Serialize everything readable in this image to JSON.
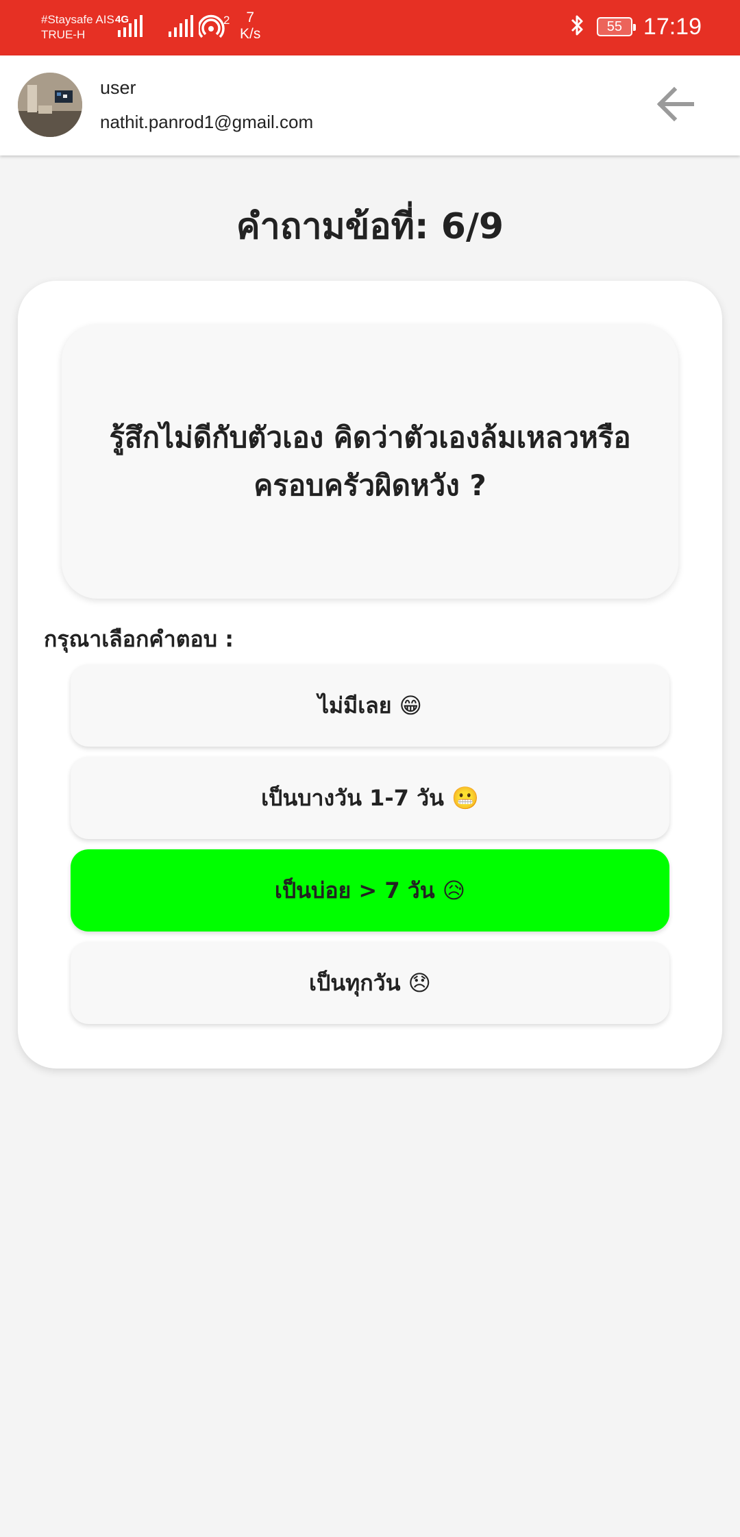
{
  "status_bar": {
    "carrier_line1": "#Staysafe AIS",
    "carrier_line2": "TRUE-H",
    "network": "4G",
    "hotspot_count": "2",
    "speed_value": "7",
    "speed_unit": "K/s",
    "battery": "55",
    "time": "17:19",
    "background_color": "#e63024"
  },
  "header": {
    "user_name": "user",
    "user_email": "nathit.panrod1@gmail.com",
    "back_icon": "arrow-left-icon"
  },
  "quiz": {
    "title": "คำถามข้อที่: 6/9",
    "question": "รู้สึกไม่ดีกับตัวเอง คิดว่าตัวเองล้มเหลวหรือครอบครัวผิดหวัง ?",
    "prompt": "กรุณาเลือกคำตอบ :",
    "options": [
      {
        "label": "ไม่มีเลย 😁",
        "selected": false
      },
      {
        "label": "เป็นบางวัน 1-7 วัน 😬",
        "selected": false
      },
      {
        "label": "เป็นบ่อย > 7 วัน 😥",
        "selected": true
      },
      {
        "label": "เป็นทุกวัน 😞",
        "selected": false
      }
    ],
    "selected_color": "#00ff00"
  }
}
